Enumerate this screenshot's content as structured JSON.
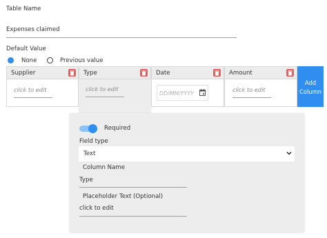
{
  "form": {
    "table_name_label": "Table Name",
    "table_name_value": "Expenses claimed",
    "default_value_label": "Default Value",
    "radio_none_label": "None",
    "radio_previous_label": "Previous value",
    "selected_default": "None"
  },
  "columns": [
    {
      "name": "Supplier",
      "placeholder": "click to edit"
    },
    {
      "name": "Type",
      "placeholder": "click to edit"
    },
    {
      "name": "Date",
      "placeholder": "DD/MM/YYYY"
    },
    {
      "name": "Amount",
      "placeholder": "click to edit"
    }
  ],
  "add_column_label": "Add Column",
  "column_settings": {
    "required_label": "Required",
    "required_on": true,
    "field_type_label": "Field type",
    "field_type_value": "Text",
    "column_name_label": "Column Name",
    "column_name_value": "Type",
    "placeholder_label": "Placeholder Text (Optional)",
    "placeholder_value": "click to edit"
  },
  "colors": {
    "accent": "#2f8ef0",
    "delete": "#e45f5f",
    "header_bg": "#ececec",
    "panel_bg": "#ededed"
  },
  "icons": [
    "trash-icon",
    "calendar-icon",
    "chevron-down-icon"
  ]
}
